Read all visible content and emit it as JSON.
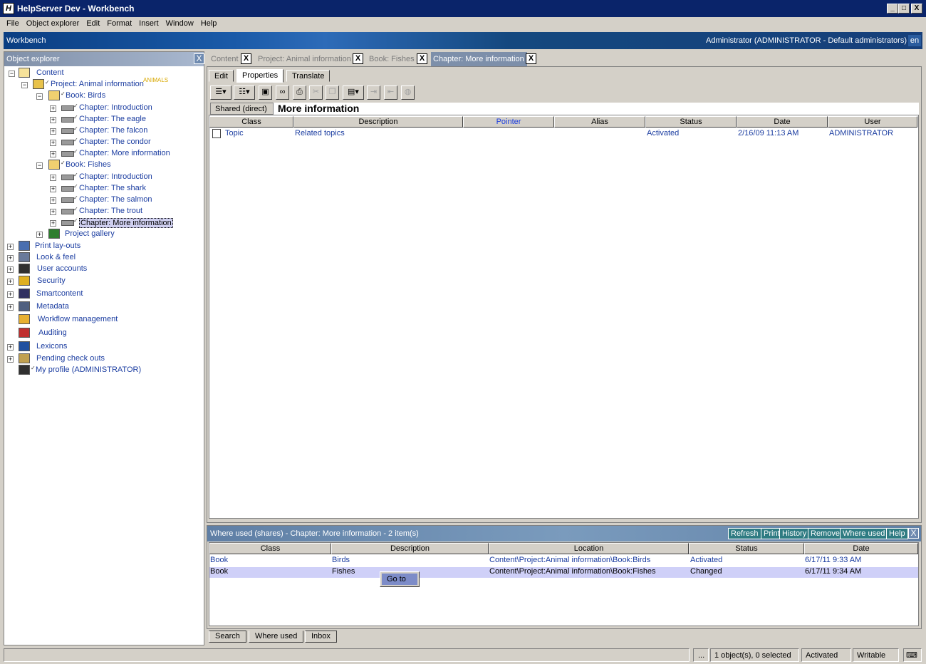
{
  "window": {
    "title": "HelpServer Dev - Workbench",
    "app_icon": "H",
    "buttons": [
      "_",
      "□",
      "X"
    ]
  },
  "menu": [
    "File",
    "Object explorer",
    "Edit",
    "Format",
    "Insert",
    "Window",
    "Help"
  ],
  "header": {
    "title": "Workbench",
    "user": "Administrator (ADMINISTRATOR - Default administrators)",
    "lang": "en"
  },
  "explorer": {
    "title": "Object explorer",
    "close": "X",
    "project_tag": "ANIMALS",
    "rows": [
      {
        "label": "Content",
        "icon": "folder-open-icon"
      },
      {
        "label": "Project: Animal information",
        "icon": "project-folder-icon"
      },
      {
        "label": "Book: Birds",
        "icon": "book-icon"
      },
      {
        "label": "Chapter: Introduction",
        "icon": "chapter-icon"
      },
      {
        "label": "Chapter: The eagle",
        "icon": "chapter-icon"
      },
      {
        "label": "Chapter: The falcon",
        "icon": "chapter-icon"
      },
      {
        "label": "Chapter: The condor",
        "icon": "chapter-icon"
      },
      {
        "label": "Chapter: More information",
        "icon": "chapter-icon"
      },
      {
        "label": "Book: Fishes",
        "icon": "book-icon"
      },
      {
        "label": "Chapter: Introduction",
        "icon": "chapter-icon"
      },
      {
        "label": "Chapter: The shark",
        "icon": "chapter-icon"
      },
      {
        "label": "Chapter: The salmon",
        "icon": "chapter-icon"
      },
      {
        "label": "Chapter: The trout",
        "icon": "chapter-icon"
      },
      {
        "label": "Chapter: More information",
        "icon": "chapter-icon"
      },
      {
        "label": "Project gallery",
        "icon": "gallery-icon"
      },
      {
        "label": "Print lay-outs",
        "icon": "printer-icon"
      },
      {
        "label": "Look & feel",
        "icon": "monitor-icon"
      },
      {
        "label": "User accounts",
        "icon": "users-icon"
      },
      {
        "label": "Security",
        "icon": "lock-icon"
      },
      {
        "label": "Smartcontent",
        "icon": "smartcontent-icon"
      },
      {
        "label": "Metadata",
        "icon": "metadata-icon"
      },
      {
        "label": "Workflow management",
        "icon": "workflow-icon"
      },
      {
        "label": "Auditing",
        "icon": "audit-chart-icon"
      },
      {
        "label": "Lexicons",
        "icon": "spellcheck-icon"
      },
      {
        "label": "Pending check outs",
        "icon": "checkout-icon"
      },
      {
        "label": "My profile (ADMINISTRATOR)",
        "icon": "user-profile-icon"
      }
    ]
  },
  "doc_tabs": [
    {
      "label": "Content"
    },
    {
      "label": "Project: Animal information"
    },
    {
      "label": "Book: Fishes"
    },
    {
      "label": "Chapter: More information"
    }
  ],
  "tab_close": "X",
  "sub_tabs": [
    "Edit",
    "Properties",
    "Translate"
  ],
  "toolbar_icons": [
    "new-list-icon",
    "properties-list-icon",
    "save-icon",
    "find-icon",
    "print-icon",
    "cut-icon",
    "copy-icon",
    "paste-icon",
    "indent-icon",
    "outdent-icon",
    "globe-icon"
  ],
  "shared_label": "Shared (direct)",
  "doc_title": "More information",
  "doc_table": {
    "columns": [
      "Class",
      "Description",
      "Pointer",
      "Alias",
      "Status",
      "Date",
      "User"
    ],
    "rows": [
      {
        "class": "Topic",
        "description": "Related topics",
        "pointer": "",
        "alias": "",
        "status": "Activated",
        "date": "2/16/09 11:13 AM",
        "user": "ADMINISTRATOR"
      }
    ]
  },
  "where_used": {
    "title": "Where used (shares) - Chapter: More information - 2 item(s)",
    "buttons": [
      "Refresh",
      "Print",
      "History",
      "Remove",
      "Where used",
      "Help"
    ],
    "close": "X",
    "columns": [
      "Class",
      "Description",
      "Location",
      "Status",
      "Date"
    ],
    "rows": [
      {
        "class": "Book",
        "description": "Birds",
        "location": "Content\\Project:Animal information\\Book:Birds",
        "status": "Activated",
        "date": "6/17/11 9:33 AM"
      },
      {
        "class": "Book",
        "description": "Fishes",
        "location": "Content\\Project:Animal information\\Book:Fishes",
        "status": "Changed",
        "date": "6/17/11 9:34 AM"
      }
    ],
    "context_menu": "Go to"
  },
  "bottom_tabs": [
    "Search",
    "Where used",
    "Inbox"
  ],
  "status": {
    "ellipsis": "...",
    "selection": "1 object(s), 0 selected",
    "state": "Activated",
    "mode": "Writable"
  }
}
